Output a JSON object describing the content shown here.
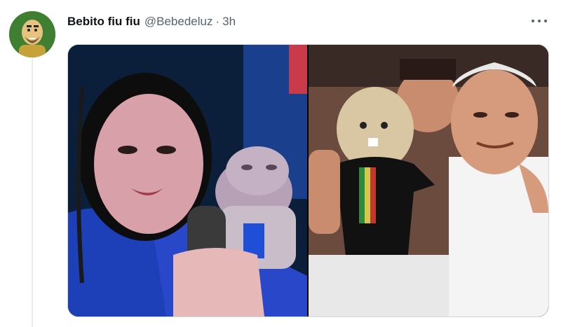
{
  "tweet": {
    "display_name": "Bebito fiu fiu",
    "handle": "@Bebedeluz",
    "separator": "·",
    "time": "3h"
  },
  "icons": {
    "more": "more-horizontal-icon",
    "avatar": "bald-man-avatar"
  },
  "colors": {
    "name": "#0f1419",
    "secondary": "#536471",
    "avatar_bg": "#3f7f31",
    "border": "#cfd9de"
  }
}
